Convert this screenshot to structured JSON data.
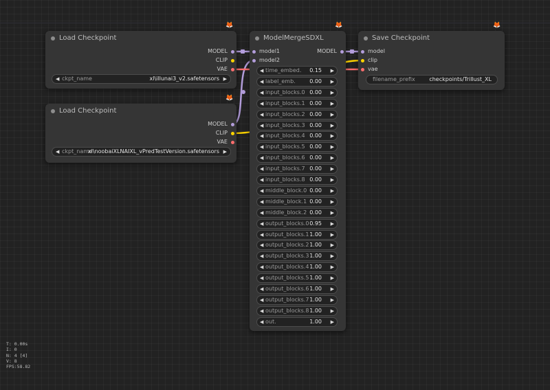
{
  "colors": {
    "model": "#b39ddb",
    "clip": "#ffd500",
    "vae": "#ff6e6e",
    "badge": "#e8623a"
  },
  "badge_icon": "fox-icon",
  "load1": {
    "title": "Load Checkpoint",
    "out_model": "MODEL",
    "out_clip": "CLIP",
    "out_vae": "VAE",
    "widget_name": "ckpt_name",
    "widget_value": "xl\\illunai3_v2.safetensors"
  },
  "load2": {
    "title": "Load Checkpoint",
    "out_model": "MODEL",
    "out_clip": "CLIP",
    "out_vae": "VAE",
    "widget_name": "ckpt_name",
    "widget_value": "xl\\noobaiXLNAIXL_vPredTestVersion.safetensors"
  },
  "merge": {
    "title": "ModelMergeSDXL",
    "in_model1": "model1",
    "in_model2": "model2",
    "out_model": "MODEL",
    "widgets": [
      {
        "name": "time_embed.",
        "value": "0.15"
      },
      {
        "name": "label_emb.",
        "value": "0.00"
      },
      {
        "name": "input_blocks.0",
        "value": "0.00"
      },
      {
        "name": "input_blocks.1",
        "value": "0.00"
      },
      {
        "name": "input_blocks.2",
        "value": "0.00"
      },
      {
        "name": "input_blocks.3",
        "value": "0.00"
      },
      {
        "name": "input_blocks.4",
        "value": "0.00"
      },
      {
        "name": "input_blocks.5",
        "value": "0.00"
      },
      {
        "name": "input_blocks.6",
        "value": "0.00"
      },
      {
        "name": "input_blocks.7",
        "value": "0.00"
      },
      {
        "name": "input_blocks.8",
        "value": "0.00"
      },
      {
        "name": "middle_block.0",
        "value": "0.00"
      },
      {
        "name": "middle_block.1",
        "value": "0.00"
      },
      {
        "name": "middle_block.2",
        "value": "0.00"
      },
      {
        "name": "output_blocks.0",
        "value": "0.95"
      },
      {
        "name": "output_blocks.1",
        "value": "1.00"
      },
      {
        "name": "output_blocks.2",
        "value": "1.00"
      },
      {
        "name": "output_blocks.3",
        "value": "1.00"
      },
      {
        "name": "output_blocks.4",
        "value": "1.00"
      },
      {
        "name": "output_blocks.5",
        "value": "1.00"
      },
      {
        "name": "output_blocks.6",
        "value": "1.00"
      },
      {
        "name": "output_blocks.7",
        "value": "1.00"
      },
      {
        "name": "output_blocks.8",
        "value": "1.00"
      },
      {
        "name": "out.",
        "value": "1.00"
      }
    ]
  },
  "save": {
    "title": "Save Checkpoint",
    "in_model": "model",
    "in_clip": "clip",
    "in_vae": "vae",
    "widget_name": "filename_prefix",
    "widget_value": "checkpoints/Trillust_XL"
  },
  "stats": {
    "t": "T: 0.00s",
    "i": "I: 0",
    "n": "N: 4 [4]",
    "v": "V: 8",
    "fps": "FPS:58.82"
  }
}
